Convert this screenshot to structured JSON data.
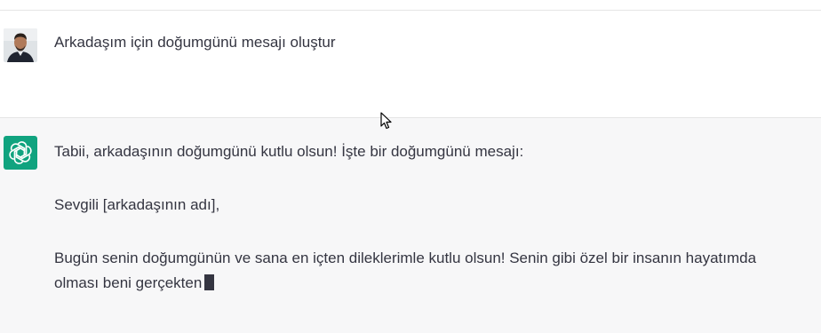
{
  "conversation": {
    "user_message": "Arkadaşım için doğumgünü mesajı oluştur",
    "assistant_paragraphs": [
      "Tabii, arkadaşının doğumgünü kutlu olsun! İşte bir doğumgünü mesajı:",
      "Sevgili [arkadaşının adı],",
      "Bugün senin doğumgünün ve sana en içten dileklerimle kutlu olsun! Senin gibi özel bir insanın hayatımda olması beni gerçekten"
    ]
  },
  "icons": {
    "user_avatar": "user-avatar-photo",
    "assistant_avatar": "openai-logo-icon",
    "mouse_cursor": "mouse-pointer-icon"
  },
  "colors": {
    "assistant_bg": "#f7f7f8",
    "logo_green": "#10a37f",
    "text": "#343541"
  }
}
